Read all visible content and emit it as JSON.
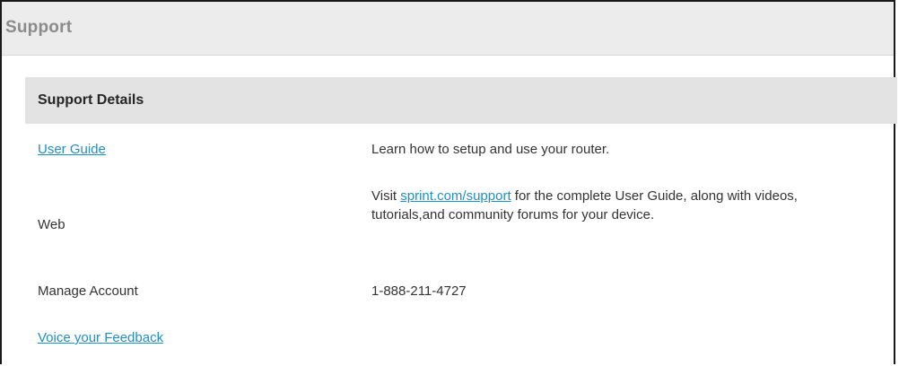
{
  "page": {
    "title": "Support"
  },
  "section": {
    "title": "Support Details"
  },
  "rows": {
    "user_guide": {
      "label": "User Guide",
      "value": "Learn how to setup and use your router."
    },
    "web": {
      "label": "Web",
      "value_prefix": "Visit ",
      "value_link": "sprint.com/support",
      "value_suffix": " for the complete User Guide, along with videos, tutorials,and community forums for your device."
    },
    "manage_account": {
      "label": "Manage Account",
      "value": "1-888-211-4727"
    },
    "feedback": {
      "label": "Voice your Feedback"
    }
  },
  "colors": {
    "link": "#1f8fc7",
    "header_bg": "#ececec",
    "section_bg": "#e3e3e3",
    "title_text": "#8b8b8b"
  }
}
